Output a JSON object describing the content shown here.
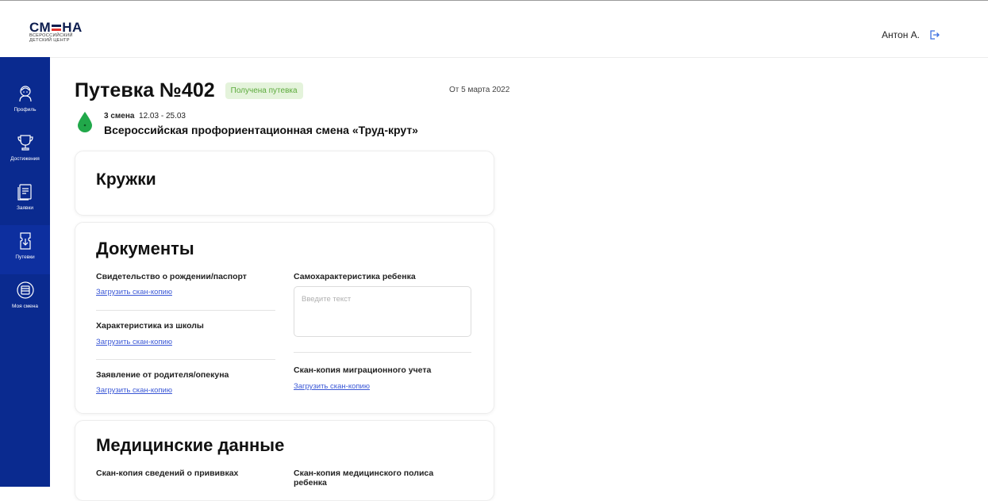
{
  "header": {
    "logo_main_left": "СМ",
    "logo_main_right": "НА",
    "logo_sub_1": "ВСЕРОССИЙСКИЙ",
    "logo_sub_2": "ДЕТСКИЙ ЦЕНТР",
    "user_name": "Антон А.",
    "logout_icon": "logout-icon"
  },
  "sidebar": {
    "items": [
      {
        "label": "Профиль",
        "icon": "profile-icon",
        "active": false
      },
      {
        "label": "Достижения",
        "icon": "trophy-icon",
        "active": false
      },
      {
        "label": "Заявки",
        "icon": "applications-icon",
        "active": false
      },
      {
        "label": "Путевки",
        "icon": "ticket-icon",
        "active": true
      },
      {
        "label": "Моя смена",
        "icon": "my-shift-icon",
        "active": false
      }
    ]
  },
  "voucher": {
    "title": "Путевка №402",
    "status": "Получена путевка",
    "date": "От 5 марта 2022",
    "shift_label": "3 смена",
    "shift_dates": "12.03 - 25.03",
    "shift_name": "Всероссийская профориентационная смена «Труд-крут»"
  },
  "circles_card": {
    "title": "Кружки"
  },
  "documents_card": {
    "title": "Документы",
    "birth_cert_label": "Свидетельство о рождении/паспорт",
    "birth_cert_link": "Загрузить скан-копию",
    "school_char_label": "Характеристика из школы",
    "school_char_link": "Загрузить скан-копию",
    "parent_statement_label": "Заявление от родителя/опекуна",
    "parent_statement_link": "Загрузить скан-копию",
    "self_char_label": "Самохарактеристика ребенка",
    "self_char_placeholder": "Введите текст",
    "migration_label": "Скан-копия миграционного учета",
    "migration_link": "Загрузить скан-копию"
  },
  "medical_card": {
    "title": "Медицинские данные",
    "vaccination_label": "Скан-копия сведений о прививках",
    "policy_label_1": "Скан-копия медицинского полиса",
    "policy_label_2": "ребенка"
  },
  "colors": {
    "sidebar": "#0a2a8f",
    "badge_bg": "#e4f3db",
    "badge_text": "#5caa3c",
    "link": "#3b58d6",
    "drop_green": "#21a84a"
  }
}
